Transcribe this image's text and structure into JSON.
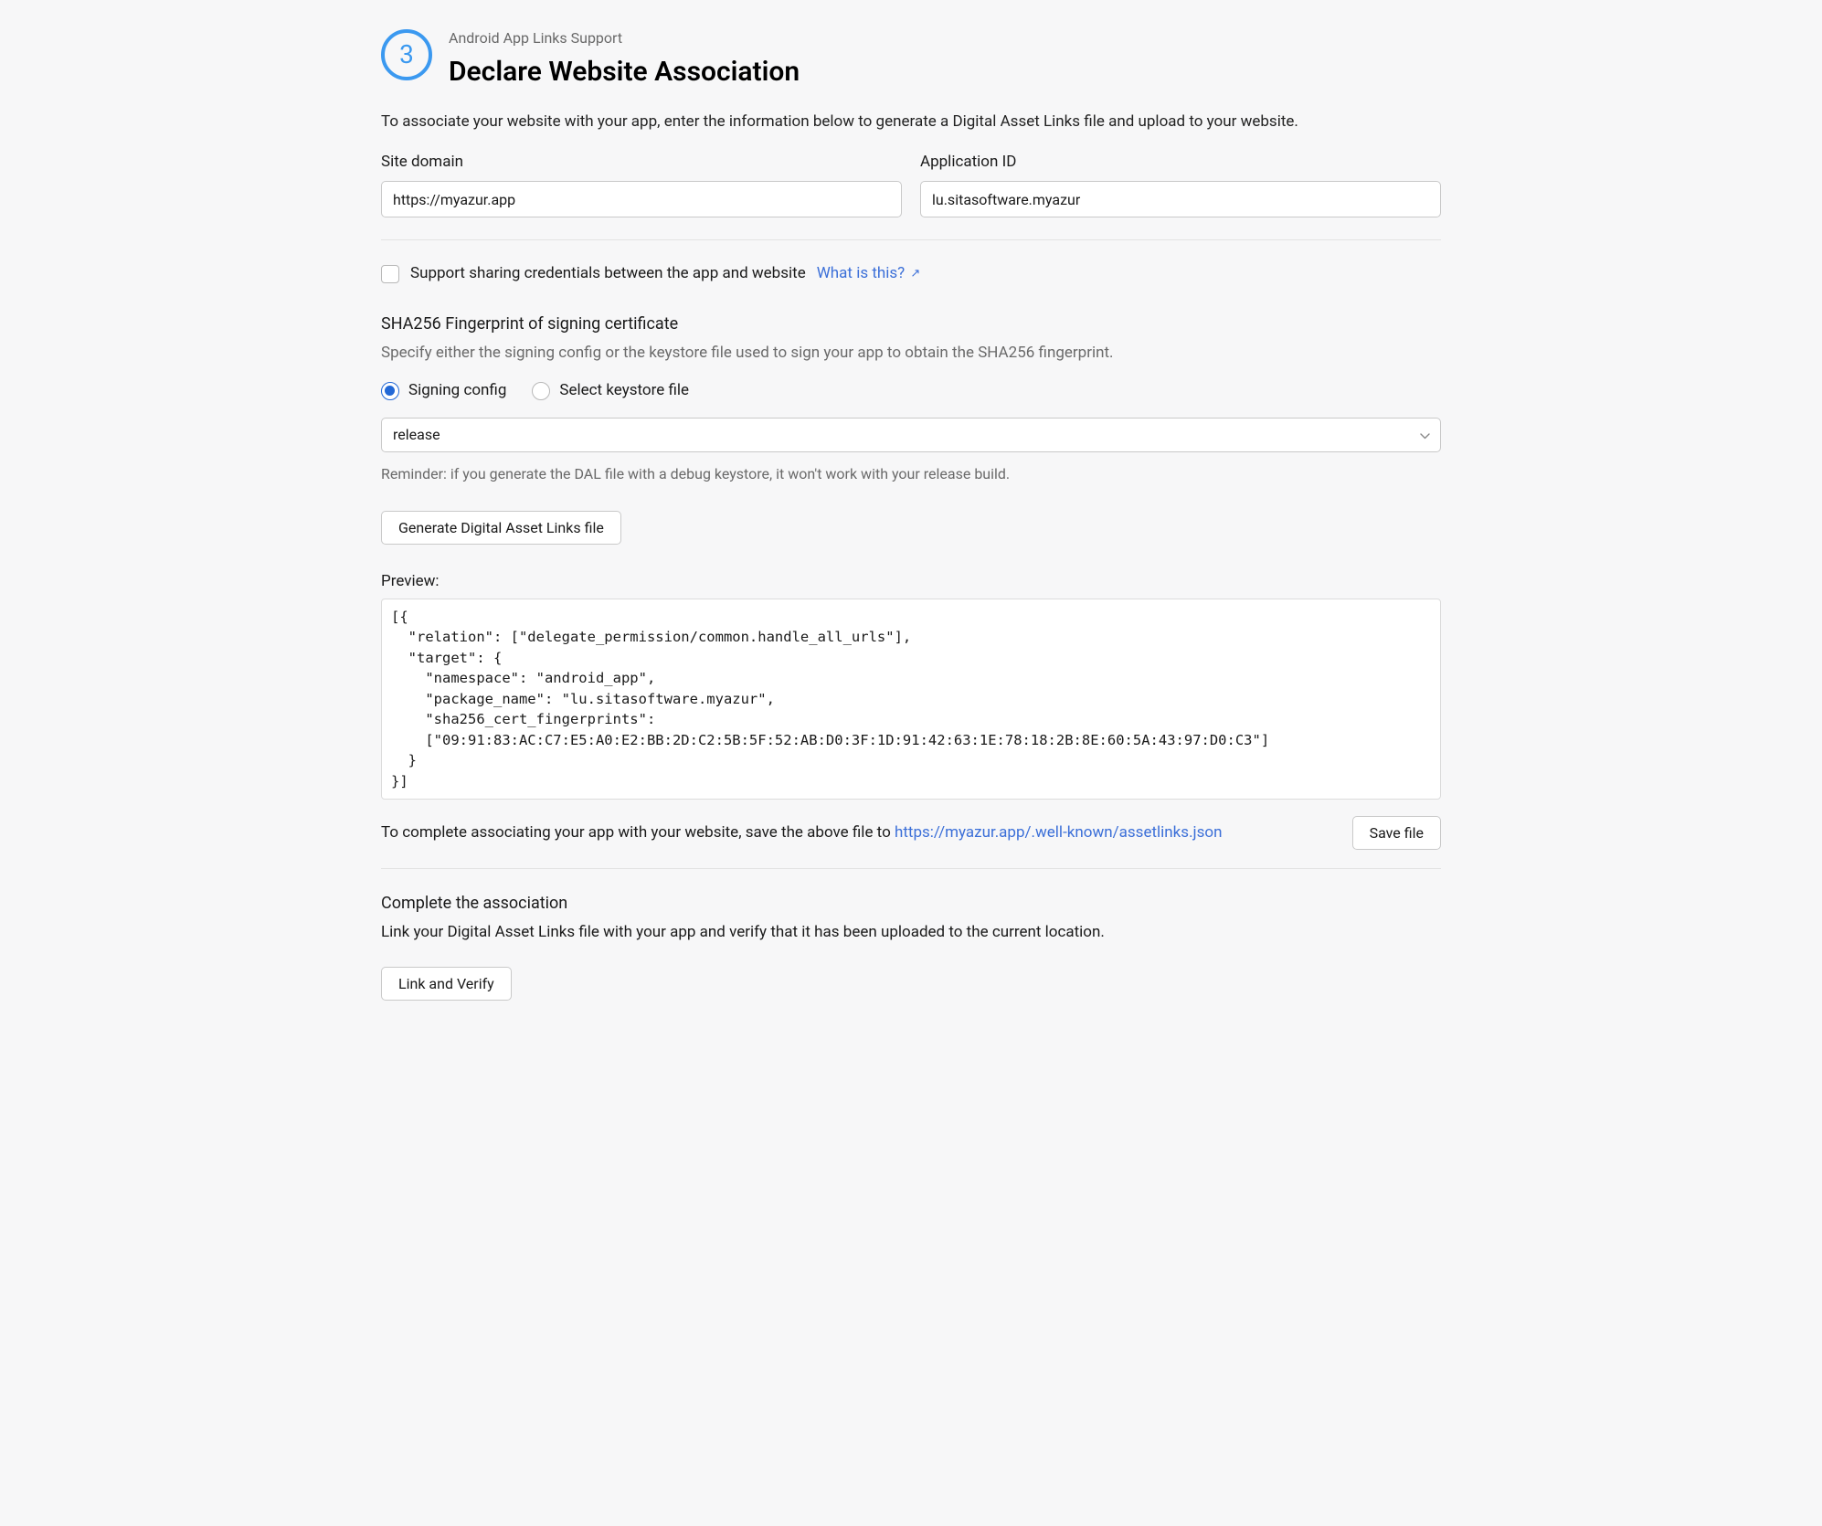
{
  "header": {
    "step_number": "3",
    "subtitle": "Android App Links Support",
    "title": "Declare Website Association"
  },
  "intro": "To associate your website with your app, enter the information below to generate a Digital Asset Links file and upload to your website.",
  "fields": {
    "site_domain_label": "Site domain",
    "site_domain_value": "https://myazur.app",
    "application_id_label": "Application ID",
    "application_id_value": "lu.sitasoftware.myazur"
  },
  "checkbox": {
    "label": "Support sharing credentials between the app and website",
    "help_link": "What is this?"
  },
  "fingerprint": {
    "heading": "SHA256 Fingerprint of signing certificate",
    "description": "Specify either the signing config or the keystore file used to sign your app to obtain the SHA256 fingerprint.",
    "radio_signing": "Signing config",
    "radio_keystore": "Select keystore file",
    "selected_option": "release",
    "reminder": "Reminder: if you generate the DAL file with a debug keystore, it won't work with your release build."
  },
  "buttons": {
    "generate": "Generate Digital Asset Links file",
    "save_file": "Save file",
    "link_verify": "Link and Verify"
  },
  "preview": {
    "label": "Preview:",
    "content": "[{\n  \"relation\": [\"delegate_permission/common.handle_all_urls\"],\n  \"target\": {\n    \"namespace\": \"android_app\",\n    \"package_name\": \"lu.sitasoftware.myazur\",\n    \"sha256_cert_fingerprints\":\n    [\"09:91:83:AC:C7:E5:A0:E2:BB:2D:C2:5B:5F:52:AB:D0:3F:1D:91:42:63:1E:78:18:2B:8E:60:5A:43:97:D0:C3\"]\n  }\n}]"
  },
  "save_instruction": {
    "prefix": "To complete associating your app with your website, save the above file to ",
    "url": "https://myazur.app/.well-known/assetlinks.json"
  },
  "complete": {
    "heading": "Complete the association",
    "text": "Link your Digital Asset Links file with your app and verify that it has been uploaded to the current location."
  }
}
